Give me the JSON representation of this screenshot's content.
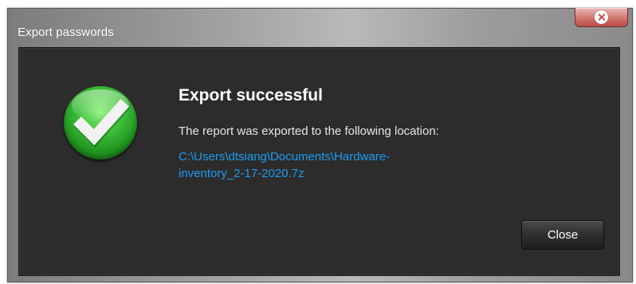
{
  "window": {
    "title": "Export passwords"
  },
  "dialog": {
    "heading": "Export successful",
    "message": "The report was exported to the following location:",
    "path_line1": "C:\\Users\\dtsiang\\Documents\\Hardware-",
    "path_line2": "inventory_2-17-2020.7z",
    "close_label": "Close"
  },
  "icons": {
    "title_close": "close-circle-icon",
    "status": "success-checkmark-icon"
  },
  "colors": {
    "panel_background": "#2c2c2c",
    "link": "#1d9bf0",
    "success_green": "#3fc23a",
    "title_close_red": "#c4615a"
  }
}
